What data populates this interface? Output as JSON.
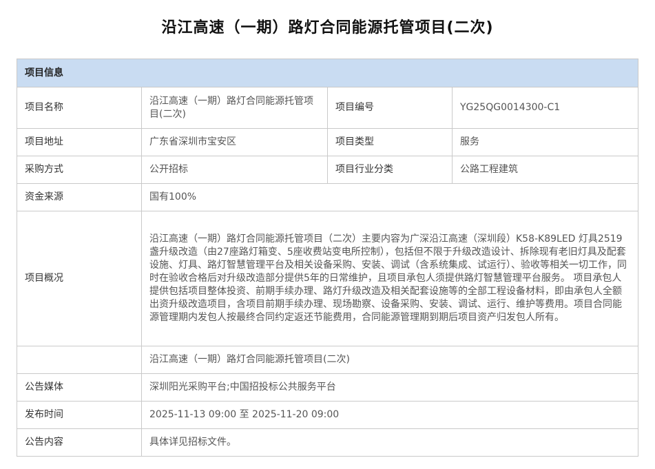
{
  "page": {
    "title": "沿江高速（一期）路灯合同能源托管项目(二次)"
  },
  "section": {
    "header": "项目信息"
  },
  "project": {
    "name_label": "项目名称",
    "name_value": "沿江高速（一期）路灯合同能源托管项目(二次)",
    "code_label": "项目编号",
    "code_value": "YG25QG0014300-C1",
    "address_label": "项目地址",
    "address_value": "广东省深圳市宝安区",
    "type_label": "项目类型",
    "type_value": "服务",
    "method_label": "采购方式",
    "method_value": "公开招标",
    "industry_label": "项目行业分类",
    "industry_value": "公路工程建筑",
    "funding_label": "资金来源",
    "funding_value": "国有100%",
    "summary_label": "项目概况",
    "summary_value": "沿江高速（一期）路灯合同能源托管项目（二次）主要内容为广深沿江高速（深圳段）K58-K89LED 灯具2519 盏升级改造（由27座路灯箱变、5座收费站变电所控制），包括但不限于升级改造设计、拆除现有老旧灯具及配套设施、灯具、路灯智慧管理平台及相关设备采购、安装、调试（含系统集成、试运行）、验收等相关一切工作，同时在验收合格后对升级改造部分提供5年的日常维护，且项目承包人须提供路灯智慧管理平台服务。 项目承包人提供包括项目整体投资、前期手续办理、路灯升级改造及相关配套设施等的全部工程设备材料，即由承包人全额出资升级改造项目，含项目前期手续办理、现场勘察、设备采购、安装、调试、运行、维护等费用。项目合同能源管理期内发包人按最终合同约定返还节能费用，合同能源管理期到期后项目资产归发包人所有。",
    "blank_label": "",
    "repeat_name_value": "沿江高速（一期）路灯合同能源托管项目(二次)",
    "media_label": "公告媒体",
    "media_value": "深圳阳光采购平台;中国招投标公共服务平台",
    "time_label": "发布时间",
    "time_value": "2025-11-13 09:00 至 2025-11-20 09:00",
    "content_label": "公告内容",
    "content_value": "具体详见招标文件。"
  },
  "colors": {
    "header_bg": "#c9dcf2",
    "border": "#c9c9c9"
  }
}
